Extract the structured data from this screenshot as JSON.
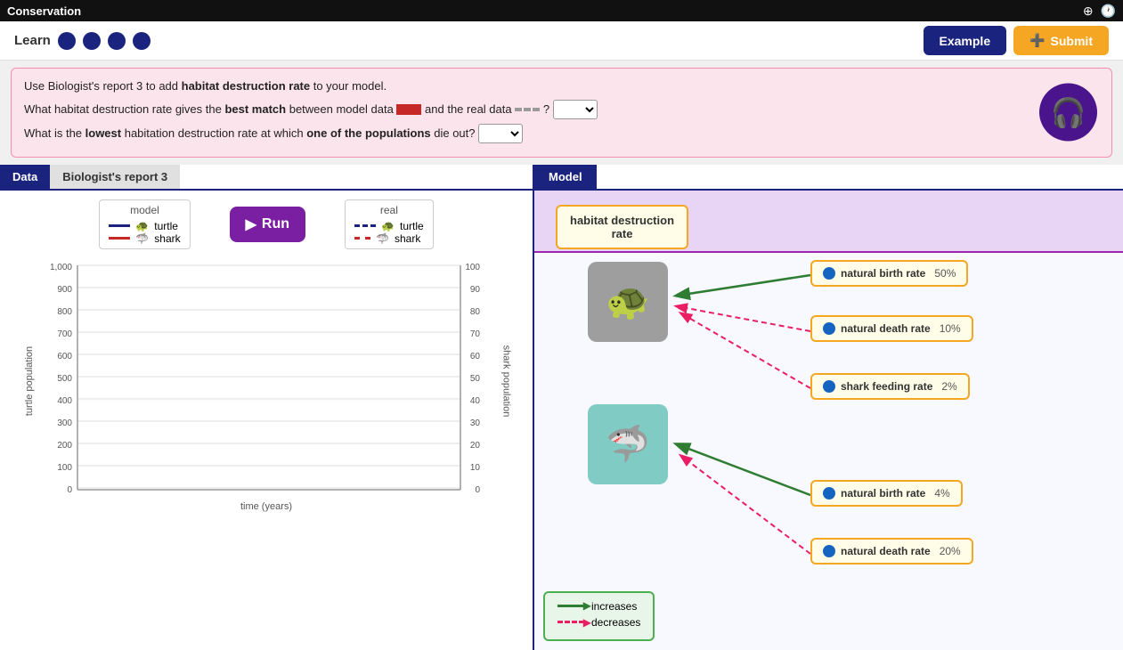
{
  "titlebar": {
    "title": "Conservation",
    "plus_icon": "⊕",
    "clock_icon": "🕐"
  },
  "header": {
    "learn_label": "Learn",
    "dots": [
      "dot1",
      "dot2",
      "dot3",
      "dot4"
    ],
    "example_btn": "Example",
    "submit_btn": "Submit"
  },
  "instructions": {
    "line1": "Use Biologist's report 3 to add habitat destruction rate to your model.",
    "line2_prefix": "What habitat destruction rate gives the ",
    "line2_bold1": "best match",
    "line2_mid": " between model data",
    "line2_end": " and the real data",
    "line2_end2": " ?",
    "line3_prefix": "What is the ",
    "line3_bold": "lowest",
    "line3_mid": " habitation destruction rate at which ",
    "line3_bold2": "one of the populations",
    "line3_end": " die out?"
  },
  "tabs": {
    "data_label": "Data",
    "biologist_label": "Biologist's report 3",
    "model_label": "Model"
  },
  "chart": {
    "legend": {
      "model_title": "model",
      "real_title": "real",
      "turtle_label": "turtle",
      "shark_label": "shark"
    },
    "y_left_label": "turtle population",
    "y_right_label": "shark population",
    "x_label": "time (years)",
    "y_left_values": [
      "1,000",
      "900",
      "800",
      "700",
      "600",
      "500",
      "400",
      "300",
      "200",
      "100",
      "0"
    ],
    "y_right_values": [
      "100",
      "90",
      "80",
      "70",
      "60",
      "50",
      "40",
      "30",
      "20",
      "10",
      "0"
    ]
  },
  "model": {
    "habitat_box": {
      "line1": "habitat destruction",
      "line2": "rate"
    },
    "turtle_emoji": "🐢",
    "shark_emoji": "🦈",
    "rates_turtle": [
      {
        "label": "natural birth rate",
        "pct": "50%",
        "id": "nbr1"
      },
      {
        "label": "natural death rate",
        "pct": "10%",
        "id": "ndr1"
      },
      {
        "label": "shark feeding rate",
        "pct": "2%",
        "id": "sfr1"
      }
    ],
    "rates_shark": [
      {
        "label": "natural birth rate",
        "pct": "4%",
        "id": "nbr2"
      },
      {
        "label": "natural death rate",
        "pct": "20%",
        "id": "ndr2"
      }
    ]
  },
  "model_legend": {
    "increases": "increases",
    "decreases": "decreases"
  }
}
